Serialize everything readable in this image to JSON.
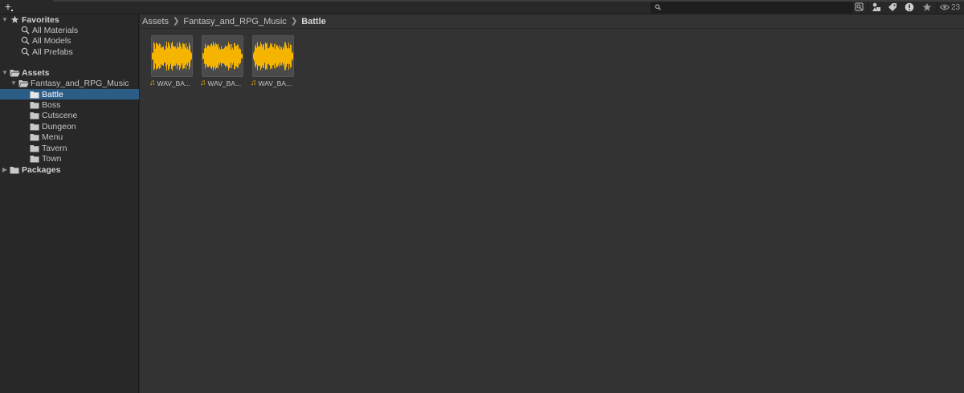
{
  "toolbar": {
    "add_label": "+",
    "search": {
      "value": "",
      "placeholder": ""
    },
    "icons": [
      "search-by-type-icon",
      "filter-by-type-icon",
      "filter-by-label-icon",
      "error-warning-icon",
      "favorite-star-icon"
    ],
    "hidden_count": "23"
  },
  "sidebar": {
    "favorites": {
      "label": "Favorites",
      "items": [
        {
          "label": "All Materials"
        },
        {
          "label": "All Models"
        },
        {
          "label": "All Prefabs"
        }
      ]
    },
    "assets": {
      "label": "Assets",
      "project": {
        "label": "Fantasy_and_RPG_Music",
        "folders": [
          {
            "label": "Battle",
            "selected": true
          },
          {
            "label": "Boss"
          },
          {
            "label": "Cutscene"
          },
          {
            "label": "Dungeon"
          },
          {
            "label": "Menu"
          },
          {
            "label": "Tavern"
          },
          {
            "label": "Town"
          }
        ]
      }
    },
    "packages": {
      "label": "Packages"
    }
  },
  "breadcrumb": {
    "items": [
      "Assets",
      "Fantasy_and_RPG_Music",
      "Battle"
    ]
  },
  "assets_grid": {
    "items": [
      {
        "label": "WAV_BA..."
      },
      {
        "label": "WAV_BA..."
      },
      {
        "label": "WAV_BA..."
      }
    ]
  },
  "colors": {
    "selection": "#2c5d87",
    "waveform": "#f4b400",
    "panel_bg": "#333333",
    "sidebar_bg": "#282828"
  }
}
